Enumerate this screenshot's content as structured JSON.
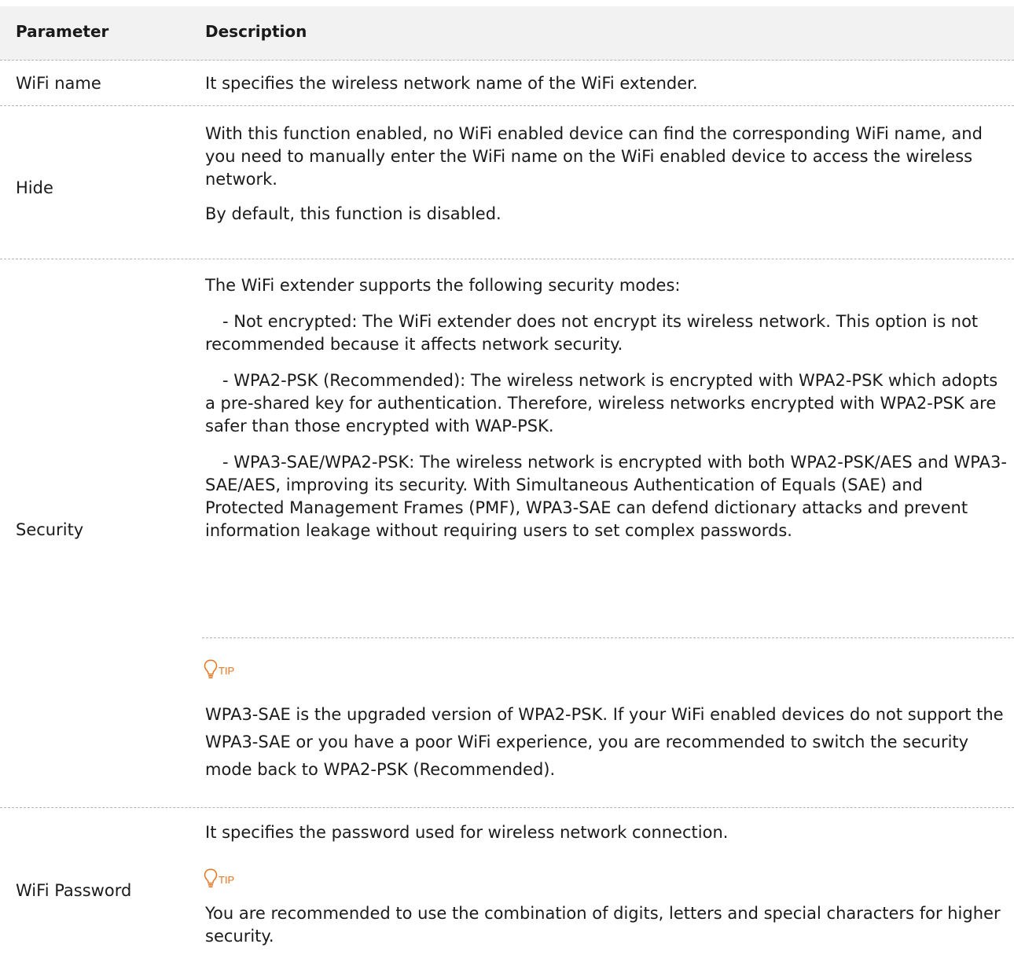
{
  "header": {
    "parameter": "Parameter",
    "description": "Description"
  },
  "rows": [
    {
      "param": "WiFi name",
      "desc": [
        "It specifies the wireless network name of the WiFi extender."
      ]
    },
    {
      "param": "Hide",
      "desc": [
        "With this function enabled, no WiFi enabled device can find the corresponding WiFi name, and you need to manually enter the WiFi name on the WiFi enabled device to access the wireless network.",
        "By default, this function is disabled."
      ]
    },
    {
      "param": "Security",
      "desc": [
        "The WiFi extender supports the following security modes:",
        "- Not encrypted: The WiFi extender does not encrypt its wireless network. This option is not recommended because it affects network security.",
        "- WPA2-PSK (Recommended): The wireless network is encrypted with WPA2-PSK which adopts a pre-shared key for authentication. Therefore, wireless networks encrypted with WPA2-PSK are safer than those encrypted with WAP-PSK.",
        "- WPA3-SAE/WPA2-PSK: The wireless network is encrypted with both WPA2-PSK/AES and WPA3-SAE/AES, improving its security. With Simultaneous Authentication of Equals (SAE) and Protected Management Frames (PMF), WPA3-SAE can defend dictionary attacks and prevent information leakage without requiring users to set complex passwords."
      ],
      "tip_label": "TIP",
      "tip_text": "WPA3-SAE is the upgraded version of WPA2-PSK. If your WiFi enabled devices do not support the WPA3-SAE or you have a poor WiFi experience, you are recommended to switch the security mode back to WPA2-PSK (Recommended)."
    },
    {
      "param": "WiFi Password",
      "desc": [
        "It specifies the password used for wireless network connection."
      ],
      "tip_label": "TIP",
      "tip_text": "You are recommended to use the combination of digits, letters and special characters for higher security."
    }
  ],
  "colors": {
    "tip": "#e8731d",
    "header_bg": "#f2f2f2",
    "divider": "#b3b3b3"
  },
  "icons": {
    "tip": "lightbulb-icon"
  }
}
